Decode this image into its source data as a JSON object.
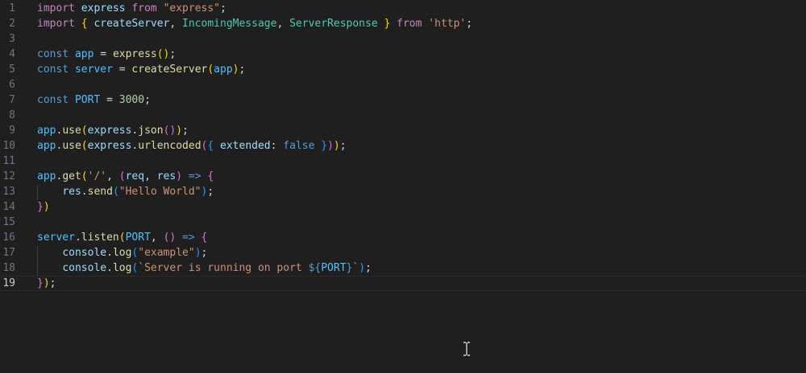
{
  "editor": {
    "lines": [
      {
        "num": "1",
        "tokens": [
          {
            "t": "import",
            "c": "kw"
          },
          {
            "t": " ",
            "c": "pl"
          },
          {
            "t": "express",
            "c": "var"
          },
          {
            "t": " ",
            "c": "pl"
          },
          {
            "t": "from",
            "c": "kw"
          },
          {
            "t": " ",
            "c": "pl"
          },
          {
            "t": "\"express\"",
            "c": "str"
          },
          {
            "t": ";",
            "c": "pl"
          }
        ]
      },
      {
        "num": "2",
        "tokens": [
          {
            "t": "import",
            "c": "kw"
          },
          {
            "t": " ",
            "c": "pl"
          },
          {
            "t": "{",
            "c": "p1"
          },
          {
            "t": " ",
            "c": "pl"
          },
          {
            "t": "createServer",
            "c": "var"
          },
          {
            "t": ", ",
            "c": "pl"
          },
          {
            "t": "IncomingMessage",
            "c": "cls"
          },
          {
            "t": ", ",
            "c": "pl"
          },
          {
            "t": "ServerResponse",
            "c": "cls"
          },
          {
            "t": " ",
            "c": "pl"
          },
          {
            "t": "}",
            "c": "p1"
          },
          {
            "t": " ",
            "c": "pl"
          },
          {
            "t": "from",
            "c": "kw"
          },
          {
            "t": " ",
            "c": "pl"
          },
          {
            "t": "'http'",
            "c": "str"
          },
          {
            "t": ";",
            "c": "pl"
          }
        ]
      },
      {
        "num": "3",
        "tokens": []
      },
      {
        "num": "4",
        "tokens": [
          {
            "t": "const",
            "c": "decl"
          },
          {
            "t": " ",
            "c": "pl"
          },
          {
            "t": "app",
            "c": "const"
          },
          {
            "t": " = ",
            "c": "pl"
          },
          {
            "t": "express",
            "c": "fn"
          },
          {
            "t": "()",
            "c": "p1"
          },
          {
            "t": ";",
            "c": "pl"
          }
        ]
      },
      {
        "num": "5",
        "tokens": [
          {
            "t": "const",
            "c": "decl"
          },
          {
            "t": " ",
            "c": "pl"
          },
          {
            "t": "server",
            "c": "const"
          },
          {
            "t": " = ",
            "c": "pl"
          },
          {
            "t": "createServer",
            "c": "fn"
          },
          {
            "t": "(",
            "c": "p1"
          },
          {
            "t": "app",
            "c": "const"
          },
          {
            "t": ")",
            "c": "p1"
          },
          {
            "t": ";",
            "c": "pl"
          }
        ]
      },
      {
        "num": "6",
        "tokens": []
      },
      {
        "num": "7",
        "tokens": [
          {
            "t": "const",
            "c": "decl"
          },
          {
            "t": " ",
            "c": "pl"
          },
          {
            "t": "PORT",
            "c": "const"
          },
          {
            "t": " = ",
            "c": "pl"
          },
          {
            "t": "3000",
            "c": "num"
          },
          {
            "t": ";",
            "c": "pl"
          }
        ]
      },
      {
        "num": "8",
        "tokens": []
      },
      {
        "num": "9",
        "tokens": [
          {
            "t": "app",
            "c": "const"
          },
          {
            "t": ".",
            "c": "pl"
          },
          {
            "t": "use",
            "c": "fn"
          },
          {
            "t": "(",
            "c": "p1"
          },
          {
            "t": "express",
            "c": "var"
          },
          {
            "t": ".",
            "c": "pl"
          },
          {
            "t": "json",
            "c": "fn"
          },
          {
            "t": "()",
            "c": "p2"
          },
          {
            "t": ")",
            "c": "p1"
          },
          {
            "t": ";",
            "c": "pl"
          }
        ]
      },
      {
        "num": "10",
        "tokens": [
          {
            "t": "app",
            "c": "const"
          },
          {
            "t": ".",
            "c": "pl"
          },
          {
            "t": "use",
            "c": "fn"
          },
          {
            "t": "(",
            "c": "p1"
          },
          {
            "t": "express",
            "c": "var"
          },
          {
            "t": ".",
            "c": "pl"
          },
          {
            "t": "urlencoded",
            "c": "fn"
          },
          {
            "t": "(",
            "c": "p2"
          },
          {
            "t": "{",
            "c": "p3"
          },
          {
            "t": " ",
            "c": "pl"
          },
          {
            "t": "extended",
            "c": "var"
          },
          {
            "t": ": ",
            "c": "pl"
          },
          {
            "t": "false",
            "c": "decl"
          },
          {
            "t": " ",
            "c": "pl"
          },
          {
            "t": "}",
            "c": "p3"
          },
          {
            "t": ")",
            "c": "p2"
          },
          {
            "t": ")",
            "c": "p1"
          },
          {
            "t": ";",
            "c": "pl"
          }
        ]
      },
      {
        "num": "11",
        "tokens": []
      },
      {
        "num": "12",
        "tokens": [
          {
            "t": "app",
            "c": "const"
          },
          {
            "t": ".",
            "c": "pl"
          },
          {
            "t": "get",
            "c": "fn"
          },
          {
            "t": "(",
            "c": "p1"
          },
          {
            "t": "'/'",
            "c": "str"
          },
          {
            "t": ", ",
            "c": "pl"
          },
          {
            "t": "(",
            "c": "p2"
          },
          {
            "t": "req",
            "c": "var"
          },
          {
            "t": ", ",
            "c": "pl"
          },
          {
            "t": "res",
            "c": "var"
          },
          {
            "t": ")",
            "c": "p2"
          },
          {
            "t": " ",
            "c": "pl"
          },
          {
            "t": "=>",
            "c": "decl"
          },
          {
            "t": " ",
            "c": "pl"
          },
          {
            "t": "{",
            "c": "p2"
          }
        ]
      },
      {
        "num": "13",
        "tokens": [
          {
            "t": "    ",
            "c": "pl"
          },
          {
            "t": "res",
            "c": "var"
          },
          {
            "t": ".",
            "c": "pl"
          },
          {
            "t": "send",
            "c": "fn"
          },
          {
            "t": "(",
            "c": "p3"
          },
          {
            "t": "\"Hello World\"",
            "c": "str"
          },
          {
            "t": ")",
            "c": "p3"
          },
          {
            "t": ";",
            "c": "pl"
          }
        ]
      },
      {
        "num": "14",
        "tokens": [
          {
            "t": "}",
            "c": "p2"
          },
          {
            "t": ")",
            "c": "p1"
          }
        ]
      },
      {
        "num": "15",
        "tokens": []
      },
      {
        "num": "16",
        "tokens": [
          {
            "t": "server",
            "c": "const"
          },
          {
            "t": ".",
            "c": "pl"
          },
          {
            "t": "listen",
            "c": "fn"
          },
          {
            "t": "(",
            "c": "p1"
          },
          {
            "t": "PORT",
            "c": "const"
          },
          {
            "t": ", ",
            "c": "pl"
          },
          {
            "t": "()",
            "c": "p2"
          },
          {
            "t": " ",
            "c": "pl"
          },
          {
            "t": "=>",
            "c": "decl"
          },
          {
            "t": " ",
            "c": "pl"
          },
          {
            "t": "{",
            "c": "p2"
          }
        ]
      },
      {
        "num": "17",
        "tokens": [
          {
            "t": "    ",
            "c": "pl"
          },
          {
            "t": "console",
            "c": "var"
          },
          {
            "t": ".",
            "c": "pl"
          },
          {
            "t": "log",
            "c": "fn"
          },
          {
            "t": "(",
            "c": "p3"
          },
          {
            "t": "\"example\"",
            "c": "str"
          },
          {
            "t": ")",
            "c": "p3"
          },
          {
            "t": ";",
            "c": "pl"
          }
        ]
      },
      {
        "num": "18",
        "tokens": [
          {
            "t": "    ",
            "c": "pl"
          },
          {
            "t": "console",
            "c": "var"
          },
          {
            "t": ".",
            "c": "pl"
          },
          {
            "t": "log",
            "c": "fn"
          },
          {
            "t": "(",
            "c": "p3"
          },
          {
            "t": "`Server is running on port ",
            "c": "str"
          },
          {
            "t": "${",
            "c": "decl"
          },
          {
            "t": "PORT",
            "c": "const"
          },
          {
            "t": "}",
            "c": "decl"
          },
          {
            "t": "`",
            "c": "str"
          },
          {
            "t": ")",
            "c": "p3"
          },
          {
            "t": ";",
            "c": "pl"
          }
        ]
      },
      {
        "num": "19",
        "tokens": [
          {
            "t": "}",
            "c": "p2"
          },
          {
            "t": ")",
            "c": "p1"
          },
          {
            "t": ";",
            "c": "pl"
          }
        ]
      }
    ],
    "current_line": 19
  },
  "icons": {
    "mouse_cursor": "text-ibeam-cursor-icon"
  }
}
